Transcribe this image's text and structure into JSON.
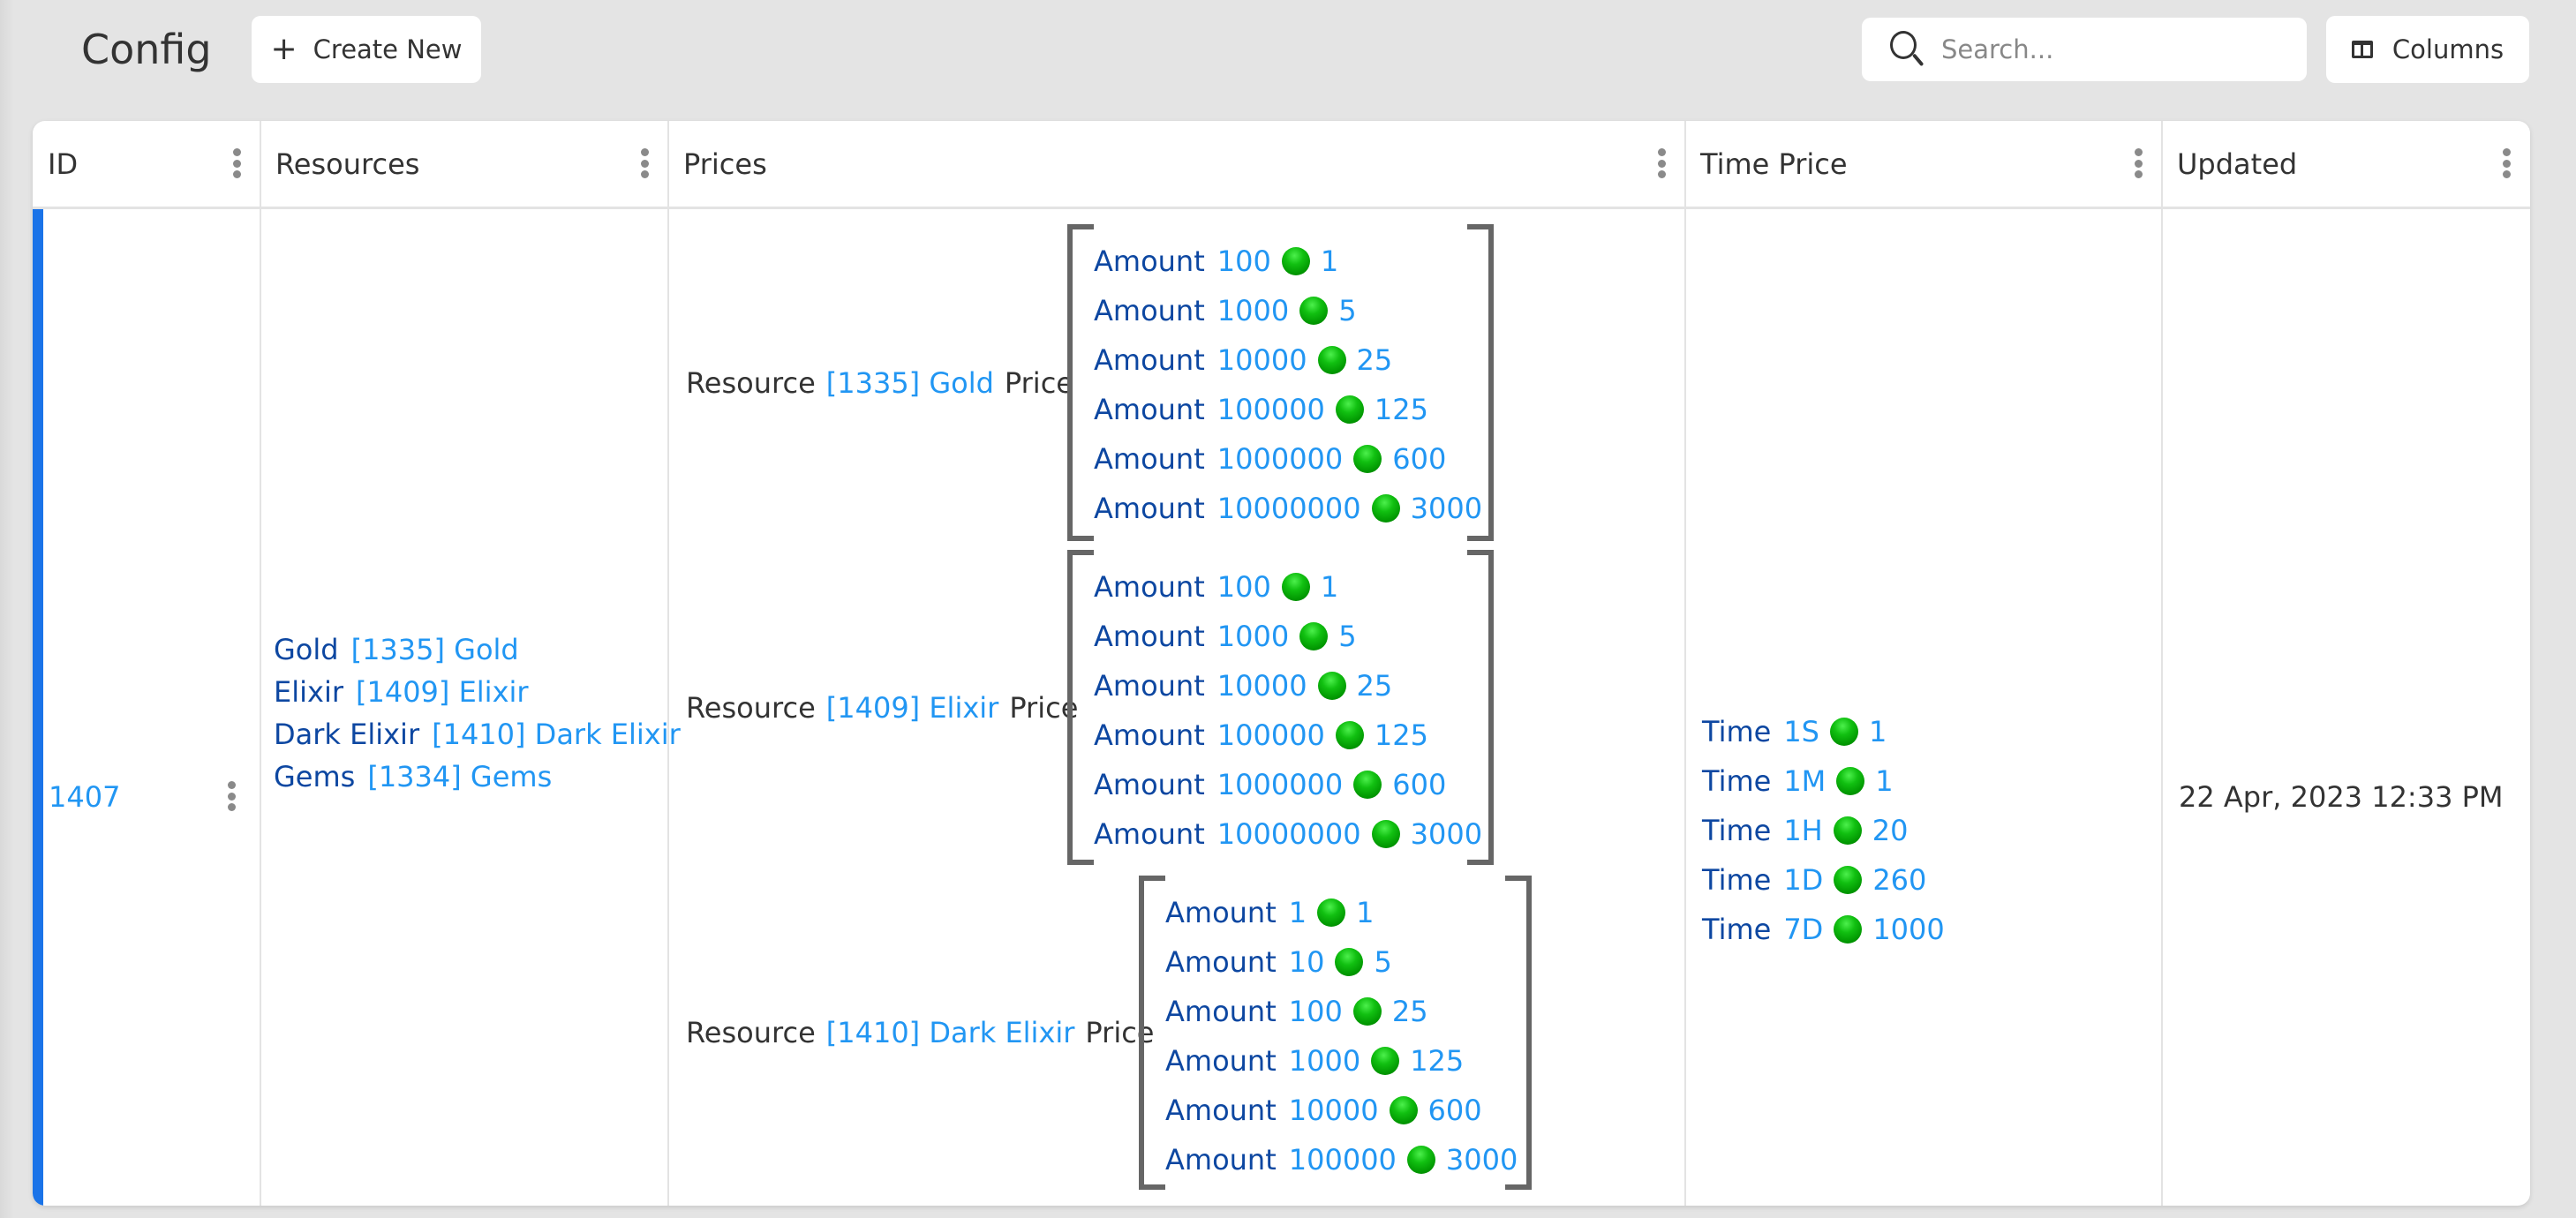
{
  "page": {
    "title": "Config"
  },
  "toolbar": {
    "create_label": "Create New",
    "create_icon": "plus-icon",
    "search_placeholder": "Search...",
    "search_value": "",
    "search_icon": "search-icon",
    "columns_label": "Columns",
    "columns_icon": "view-columns-icon"
  },
  "colors": {
    "background": "#e4e4e4",
    "accent": "#1a73e8",
    "link_light": "#2196f3",
    "label_dark": "#0d47a1",
    "gem": "#00a000"
  },
  "table": {
    "columns": [
      {
        "key": "id",
        "label": "ID"
      },
      {
        "key": "resources",
        "label": "Resources"
      },
      {
        "key": "prices",
        "label": "Prices"
      },
      {
        "key": "time_price",
        "label": "Time Price"
      },
      {
        "key": "updated",
        "label": "Updated"
      }
    ],
    "rows": [
      {
        "id": "1407",
        "resources": [
          {
            "name": "Gold",
            "ref": "[1335] Gold"
          },
          {
            "name": "Elixir",
            "ref": "[1409] Elixir"
          },
          {
            "name": "Dark Elixir",
            "ref": "[1410] Dark Elixir"
          },
          {
            "name": "Gems",
            "ref": "[1334] Gems"
          }
        ],
        "prices": [
          {
            "resource_label": "Resource",
            "resource_ref": "[1335] Gold",
            "price_label": "Price",
            "tiers": [
              {
                "label": "Amount",
                "amount": "100",
                "price": "1"
              },
              {
                "label": "Amount",
                "amount": "1000",
                "price": "5"
              },
              {
                "label": "Amount",
                "amount": "10000",
                "price": "25"
              },
              {
                "label": "Amount",
                "amount": "100000",
                "price": "125"
              },
              {
                "label": "Amount",
                "amount": "1000000",
                "price": "600"
              },
              {
                "label": "Amount",
                "amount": "10000000",
                "price": "3000"
              }
            ]
          },
          {
            "resource_label": "Resource",
            "resource_ref": "[1409] Elixir",
            "price_label": "Price",
            "tiers": [
              {
                "label": "Amount",
                "amount": "100",
                "price": "1"
              },
              {
                "label": "Amount",
                "amount": "1000",
                "price": "5"
              },
              {
                "label": "Amount",
                "amount": "10000",
                "price": "25"
              },
              {
                "label": "Amount",
                "amount": "100000",
                "price": "125"
              },
              {
                "label": "Amount",
                "amount": "1000000",
                "price": "600"
              },
              {
                "label": "Amount",
                "amount": "10000000",
                "price": "3000"
              }
            ]
          },
          {
            "resource_label": "Resource",
            "resource_ref": "[1410] Dark Elixir",
            "price_label": "Price",
            "tiers": [
              {
                "label": "Amount",
                "amount": "1",
                "price": "1"
              },
              {
                "label": "Amount",
                "amount": "10",
                "price": "5"
              },
              {
                "label": "Amount",
                "amount": "100",
                "price": "25"
              },
              {
                "label": "Amount",
                "amount": "1000",
                "price": "125"
              },
              {
                "label": "Amount",
                "amount": "10000",
                "price": "600"
              },
              {
                "label": "Amount",
                "amount": "100000",
                "price": "3000"
              }
            ]
          }
        ],
        "time_price": [
          {
            "label": "Time",
            "time": "1S",
            "price": "1"
          },
          {
            "label": "Time",
            "time": "1M",
            "price": "1"
          },
          {
            "label": "Time",
            "time": "1H",
            "price": "20"
          },
          {
            "label": "Time",
            "time": "1D",
            "price": "260"
          },
          {
            "label": "Time",
            "time": "7D",
            "price": "1000"
          }
        ],
        "updated": "22 Apr, 2023 12:33 PM"
      }
    ]
  }
}
